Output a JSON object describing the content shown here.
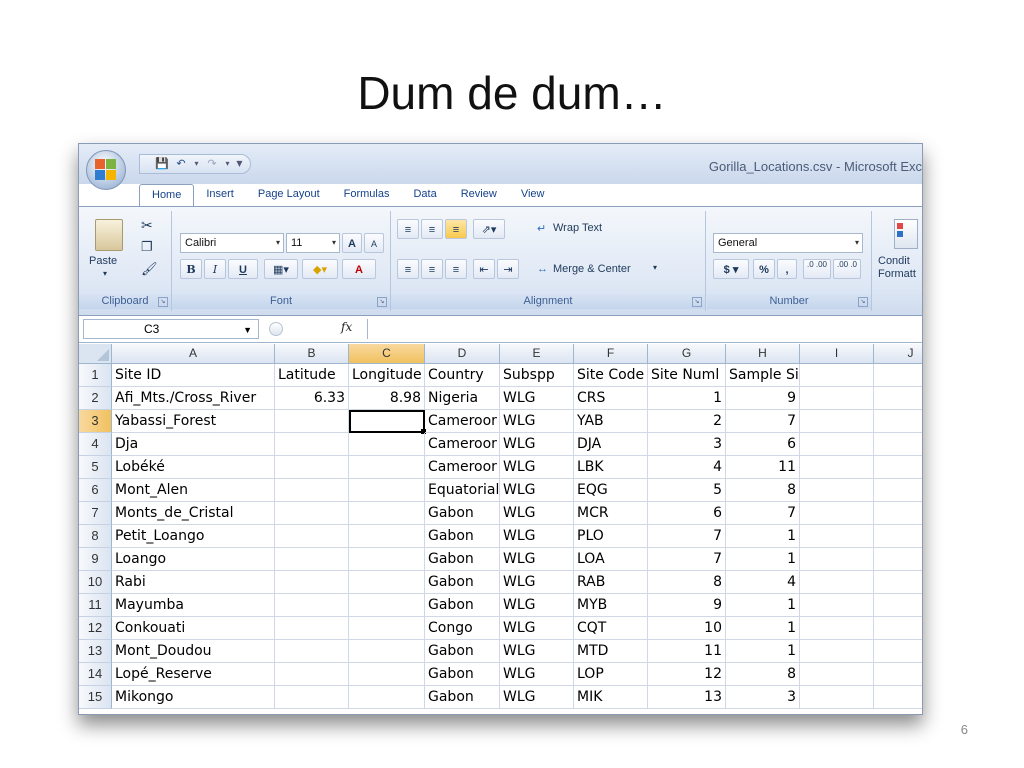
{
  "slide": {
    "title": "Dum de dum…",
    "page_number": "6"
  },
  "window": {
    "title": "Gorilla_Locations.csv - Microsoft Exc"
  },
  "tabs": [
    "Home",
    "Insert",
    "Page Layout",
    "Formulas",
    "Data",
    "Review",
    "View"
  ],
  "ribbon": {
    "clipboard": {
      "paste": "Paste",
      "label": "Clipboard"
    },
    "font": {
      "name": "Calibri",
      "size": "11",
      "bold": "B",
      "italic": "I",
      "underline": "U",
      "grow": "A",
      "shrink": "A",
      "color": "A",
      "label": "Font"
    },
    "alignment": {
      "wrap_text": "Wrap Text",
      "merge_center": "Merge & Center",
      "label": "Alignment"
    },
    "number": {
      "format": "General",
      "currency": "$",
      "percent": "%",
      "comma": ",",
      "inc_decimal": ".0 .00",
      "dec_decimal": ".00 .0",
      "label": "Number"
    },
    "styles": {
      "conditional": "Condit",
      "formatting": "Formatt"
    }
  },
  "formula_bar": {
    "name_box": "C3",
    "fx": "fx",
    "value": ""
  },
  "columns": [
    "A",
    "B",
    "C",
    "D",
    "E",
    "F",
    "G",
    "H",
    "I",
    "J"
  ],
  "selected_column": "C",
  "selected_row": "3",
  "rows": [
    {
      "n": "1",
      "cells": [
        "Site ID",
        "Latitude",
        "Longitude",
        "Country",
        "Subspp",
        "Site Code",
        "Site Numl",
        "Sample Size",
        "",
        ""
      ]
    },
    {
      "n": "2",
      "cells": [
        "Afi_Mts./Cross_River",
        "6.33",
        "8.98",
        "Nigeria",
        "WLG",
        "CRS",
        "1",
        "9",
        "",
        ""
      ]
    },
    {
      "n": "3",
      "cells": [
        "Yabassi_Forest",
        "",
        "",
        "Cameroor",
        "WLG",
        "YAB",
        "2",
        "7",
        "",
        ""
      ]
    },
    {
      "n": "4",
      "cells": [
        "Dja",
        "",
        "",
        "Cameroor",
        "WLG",
        "DJA",
        "3",
        "6",
        "",
        ""
      ]
    },
    {
      "n": "5",
      "cells": [
        "Lobéké",
        "",
        "",
        "Cameroor",
        "WLG",
        "LBK",
        "4",
        "11",
        "",
        ""
      ]
    },
    {
      "n": "6",
      "cells": [
        "Mont_Alen",
        "",
        "",
        "Equatorial",
        "WLG",
        "EQG",
        "5",
        "8",
        "",
        ""
      ]
    },
    {
      "n": "7",
      "cells": [
        "Monts_de_Cristal",
        "",
        "",
        "Gabon",
        "WLG",
        "MCR",
        "6",
        "7",
        "",
        ""
      ]
    },
    {
      "n": "8",
      "cells": [
        "Petit_Loango",
        "",
        "",
        "Gabon",
        "WLG",
        "PLO",
        "7",
        "1",
        "",
        ""
      ]
    },
    {
      "n": "9",
      "cells": [
        "Loango",
        "",
        "",
        "Gabon",
        "WLG",
        "LOA",
        "7",
        "1",
        "",
        ""
      ]
    },
    {
      "n": "10",
      "cells": [
        "Rabi",
        "",
        "",
        "Gabon",
        "WLG",
        "RAB",
        "8",
        "4",
        "",
        ""
      ]
    },
    {
      "n": "11",
      "cells": [
        "Mayumba",
        "",
        "",
        "Gabon",
        "WLG",
        "MYB",
        "9",
        "1",
        "",
        ""
      ]
    },
    {
      "n": "12",
      "cells": [
        "Conkouati",
        "",
        "",
        "Congo",
        "WLG",
        "CQT",
        "10",
        "1",
        "",
        ""
      ]
    },
    {
      "n": "13",
      "cells": [
        "Mont_Doudou",
        "",
        "",
        "Gabon",
        "WLG",
        "MTD",
        "11",
        "1",
        "",
        ""
      ]
    },
    {
      "n": "14",
      "cells": [
        "Lopé_Reserve",
        "",
        "",
        "Gabon",
        "WLG",
        "LOP",
        "12",
        "8",
        "",
        ""
      ]
    },
    {
      "n": "15",
      "cells": [
        "Mikongo",
        "",
        "",
        "Gabon",
        "WLG",
        "MIK",
        "13",
        "3",
        "",
        ""
      ]
    }
  ],
  "numeric_columns": [
    1,
    2,
    6,
    7
  ],
  "colors": {
    "accent": "#15428b",
    "selected_header": "#f1c15f",
    "gridline": "#d0d7e5"
  }
}
